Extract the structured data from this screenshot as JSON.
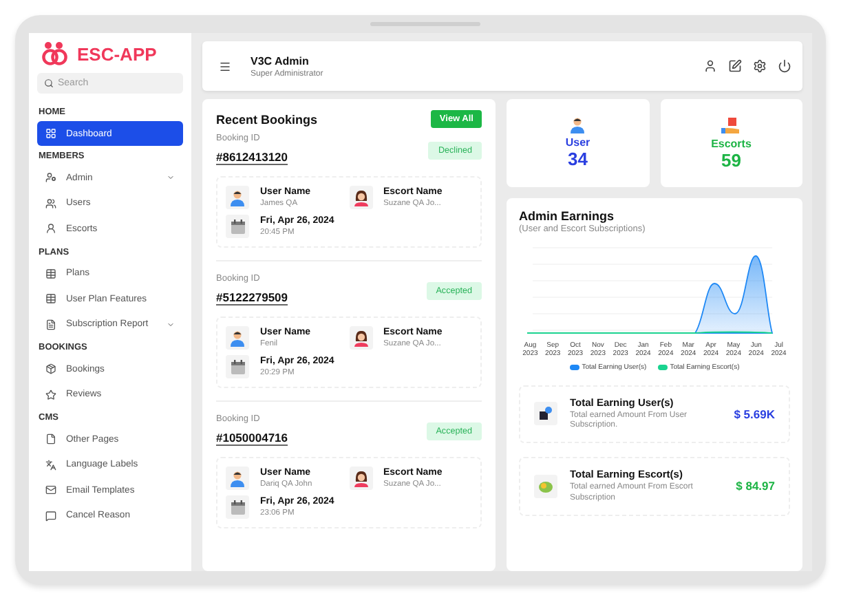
{
  "brand": {
    "name": "ESC-APP"
  },
  "search": {
    "placeholder": "Search"
  },
  "sidebar": {
    "items": [
      {
        "kind": "section",
        "label": "HOME"
      },
      {
        "kind": "item",
        "label": "Dashboard",
        "selected": true,
        "has_submenu": false
      },
      {
        "kind": "section",
        "label": "MEMBERS"
      },
      {
        "kind": "item",
        "label": "Admin",
        "selected": false,
        "has_submenu": true
      },
      {
        "kind": "item",
        "label": "Users",
        "selected": false,
        "has_submenu": false
      },
      {
        "kind": "item",
        "label": "Escorts",
        "selected": false,
        "has_submenu": false
      },
      {
        "kind": "section",
        "label": "PLANS"
      },
      {
        "kind": "item",
        "label": "Plans",
        "selected": false,
        "has_submenu": false
      },
      {
        "kind": "item",
        "label": "User Plan Features",
        "selected": false,
        "has_submenu": false
      },
      {
        "kind": "item",
        "label": "Subscription Report",
        "selected": false,
        "has_submenu": true
      },
      {
        "kind": "section",
        "label": "BOOKINGS"
      },
      {
        "kind": "item",
        "label": "Bookings",
        "selected": false,
        "has_submenu": false
      },
      {
        "kind": "item",
        "label": "Reviews",
        "selected": false,
        "has_submenu": false
      },
      {
        "kind": "section",
        "label": "CMS"
      },
      {
        "kind": "item",
        "label": "Other Pages",
        "selected": false,
        "has_submenu": false
      },
      {
        "kind": "item",
        "label": "Language Labels",
        "selected": false,
        "has_submenu": false
      },
      {
        "kind": "item",
        "label": "Email Templates",
        "selected": false,
        "has_submenu": false
      },
      {
        "kind": "item",
        "label": "Cancel Reason",
        "selected": false,
        "has_submenu": false
      }
    ]
  },
  "header": {
    "title": "V3C Admin",
    "subtitle": "Super Administrator"
  },
  "recent_bookings": {
    "title": "Recent Bookings",
    "button": "View All",
    "bookings": [
      {
        "id_label": "Booking ID",
        "user_label": "User Name",
        "escort_label": "Escort Name",
        "id": "#8612413120",
        "status": "Declined",
        "user": "James QA",
        "escort": "Suzane QA Jo...",
        "date": "Fri, Apr 26, 2024",
        "time": "20:45 PM"
      },
      {
        "id_label": "Booking ID",
        "user_label": "User Name",
        "escort_label": "Escort Name",
        "id": "#5122279509",
        "status": "Accepted",
        "user": "Fenil",
        "escort": "Suzane QA Jo...",
        "date": "Fri, Apr 26, 2024",
        "time": "20:29 PM"
      },
      {
        "id_label": "Booking ID",
        "user_label": "User Name",
        "escort_label": "Escort Name",
        "id": "#1050004716",
        "status": "Accepted",
        "user": "Dariq QA John",
        "escort": "Suzane QA Jo...",
        "date": "Fri, Apr 26, 2024",
        "time": "23:06 PM"
      }
    ]
  },
  "stats": [
    {
      "label": "User",
      "value": "34",
      "color": "#2a3fe0"
    },
    {
      "label": "Escorts",
      "value": "59",
      "color": "#1db445"
    }
  ],
  "earnings": {
    "title": "Admin Earnings",
    "subtitle": "(User and Escort Subscriptions)",
    "x_labels": [
      {
        "month": "Aug",
        "year": "2023"
      },
      {
        "month": "Sep",
        "year": "2023"
      },
      {
        "month": "Oct",
        "year": "2023"
      },
      {
        "month": "Nov",
        "year": "2023"
      },
      {
        "month": "Dec",
        "year": "2023"
      },
      {
        "month": "Jan",
        "year": "2024"
      },
      {
        "month": "Feb",
        "year": "2024"
      },
      {
        "month": "Mar",
        "year": "2024"
      },
      {
        "month": "Apr",
        "year": "2024"
      },
      {
        "month": "May",
        "year": "2024"
      },
      {
        "month": "Jun",
        "year": "2024"
      },
      {
        "month": "Jul",
        "year": "2024"
      }
    ],
    "legend": [
      {
        "name": "Total Earning User(s)",
        "color": "#1e88f5"
      },
      {
        "name": "Total Earning Escort(s)",
        "color": "#19d38f"
      }
    ],
    "totals": [
      {
        "title": "Total Earning User(s)",
        "description": "Total earned Amount From User Subscription.",
        "amount": "$ 5.69K",
        "color": "#2a3fe0"
      },
      {
        "title": "Total Earning Escort(s)",
        "description": "Total earned Amount From Escort Subscription",
        "amount": "$ 84.97",
        "color": "#1db445"
      }
    ]
  }
}
